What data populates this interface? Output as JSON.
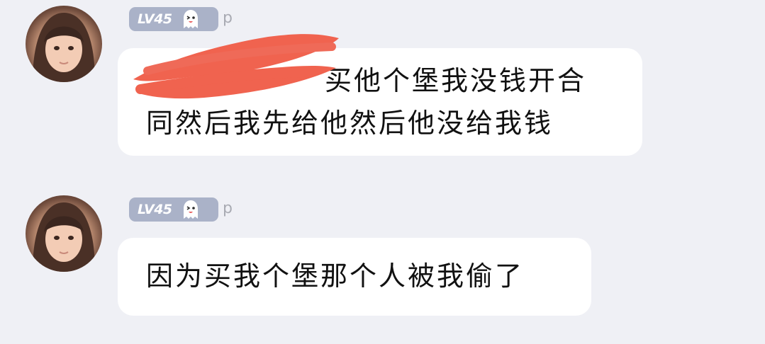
{
  "messages": [
    {
      "level": "LV45",
      "username": "p",
      "lines": [
        "买他个堡我没钱开合",
        "同然后我先给他然后他没给我钱"
      ]
    },
    {
      "level": "LV45",
      "username": "p",
      "lines": [
        "因为买我个堡那个人被我偷了"
      ]
    }
  ],
  "colors": {
    "background": "#eff0f5",
    "bubble": "#ffffff",
    "badge": "#aab2c8",
    "redaction": "#f0634f"
  }
}
